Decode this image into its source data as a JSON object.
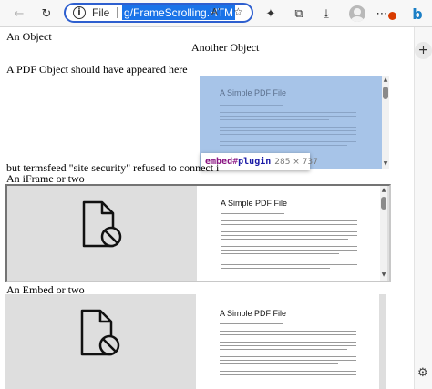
{
  "browser": {
    "address_bar": {
      "scheme_label": "File",
      "url_visible": "g/FrameScrolling.HTM",
      "read_aloud_label": "A’"
    },
    "icons": [
      "back-icon",
      "refresh-icon",
      "info-icon",
      "read-aloud-icon",
      "favorite-star-icon",
      "favorites-icon",
      "collections-icon",
      "downloads-icon",
      "profile-avatar",
      "more-icon",
      "bing-icon",
      "add-icon",
      "settings-icon"
    ]
  },
  "page": {
    "object_label": "An Object",
    "another_object_label": "Another Object",
    "pdf_object_text": "A PDF Object should have appeared here",
    "termsfeed_text": "but termsfeed \"site security\" refused to connect i",
    "iframe_label": "An iFrame or two",
    "embed_label": "An Embed or two"
  },
  "pdf": {
    "title": "A Simple PDF File"
  },
  "tooltip": {
    "tag": "embed",
    "separator": "#",
    "name": "plugin",
    "dimensions": "285 × 737"
  },
  "colors": {
    "highlight_blue": "#a7c4e8",
    "url_selection": "#1a73e8",
    "address_border": "#2e5fcf",
    "frame_gray": "#dedede",
    "notification_badge": "#d83b01"
  }
}
